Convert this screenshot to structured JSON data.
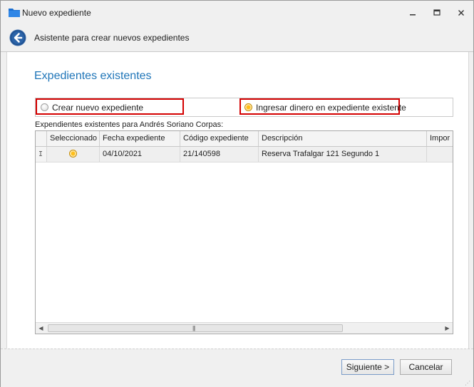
{
  "window": {
    "title": "Nuevo expediente"
  },
  "wizard": {
    "title": "Asistente para crear nuevos expedientes"
  },
  "section": {
    "title": "Expedientes existentes"
  },
  "options": [
    {
      "label": "Crear nuevo expediente",
      "selected": false
    },
    {
      "label": "Ingresar dinero en expediente existente",
      "selected": true
    }
  ],
  "grid": {
    "caption": "Expendientes existentes para Andrés Soriano Corpas:",
    "columns": [
      "Seleccionado",
      "Fecha expediente",
      "Código expediente",
      "Descripción",
      "Impor"
    ],
    "rows": [
      {
        "indicator": "I",
        "selected": true,
        "fecha": "04/10/2021",
        "codigo": "21/140598",
        "descripcion": "Reserva Trafalgar 121 Segundo 1",
        "importe": ""
      }
    ],
    "scroll_fraction": 0.73
  },
  "buttons": {
    "next": "Siguiente >",
    "cancel": "Cancelar"
  },
  "colors": {
    "accent": "#1f75b8",
    "highlight_border": "#d40000",
    "radio_selected": "#ffbe1a"
  }
}
